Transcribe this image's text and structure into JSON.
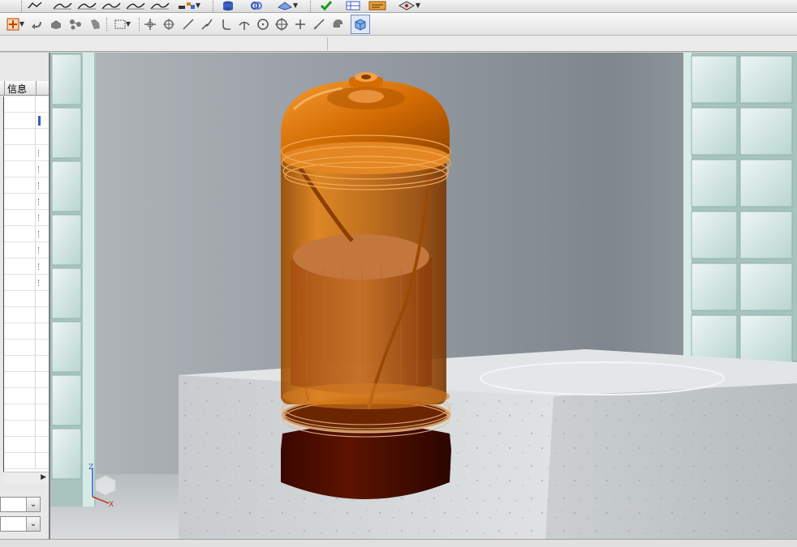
{
  "window": {
    "width": 982,
    "height": 675
  },
  "toolbar_row1": {
    "items": [
      "line-chart-icon",
      "surface-sweep-icon",
      "surface-sweep-icon",
      "surface-sweep-icon",
      "surface-sweep-icon",
      "surface-sweep-icon",
      "surface-sweep-icon",
      "dropdown-icon",
      "database-icon",
      "link-icon",
      "stack-icon",
      "checkmark-icon",
      "grid-icon",
      "text-box-icon",
      "display-icon"
    ]
  },
  "toolbar_row2": {
    "items": [
      "add-frame-icon",
      "undo-arrow-icon",
      "solid-shape-icon",
      "network-icon",
      "hand-icon",
      "selection-box-icon",
      "move-icon",
      "rotate-icon",
      "line-tool-icon",
      "curve-tool-icon",
      "hook-tool-icon",
      "split-tool-icon",
      "circle-tool-icon",
      "center-circle-icon",
      "plus-tool-icon",
      "slash-tool-icon",
      "head-icon",
      "cube-view-icon"
    ]
  },
  "left_panel": {
    "column_header": "信息",
    "rows": 23,
    "selected_row": 1,
    "marked_rows": [
      3,
      4,
      5,
      6,
      7,
      8,
      9,
      10,
      11
    ]
  },
  "viewport": {
    "axis_labels": {
      "z": "Z",
      "x": "X"
    },
    "colors": {
      "wall": "#8c9298",
      "floor": "#c4c9cb",
      "glass_brick": "#cfe3de",
      "pedestal": "#d7dbdc",
      "vessel_orange": "#c86400",
      "vessel_base": "#4a0d00"
    }
  }
}
